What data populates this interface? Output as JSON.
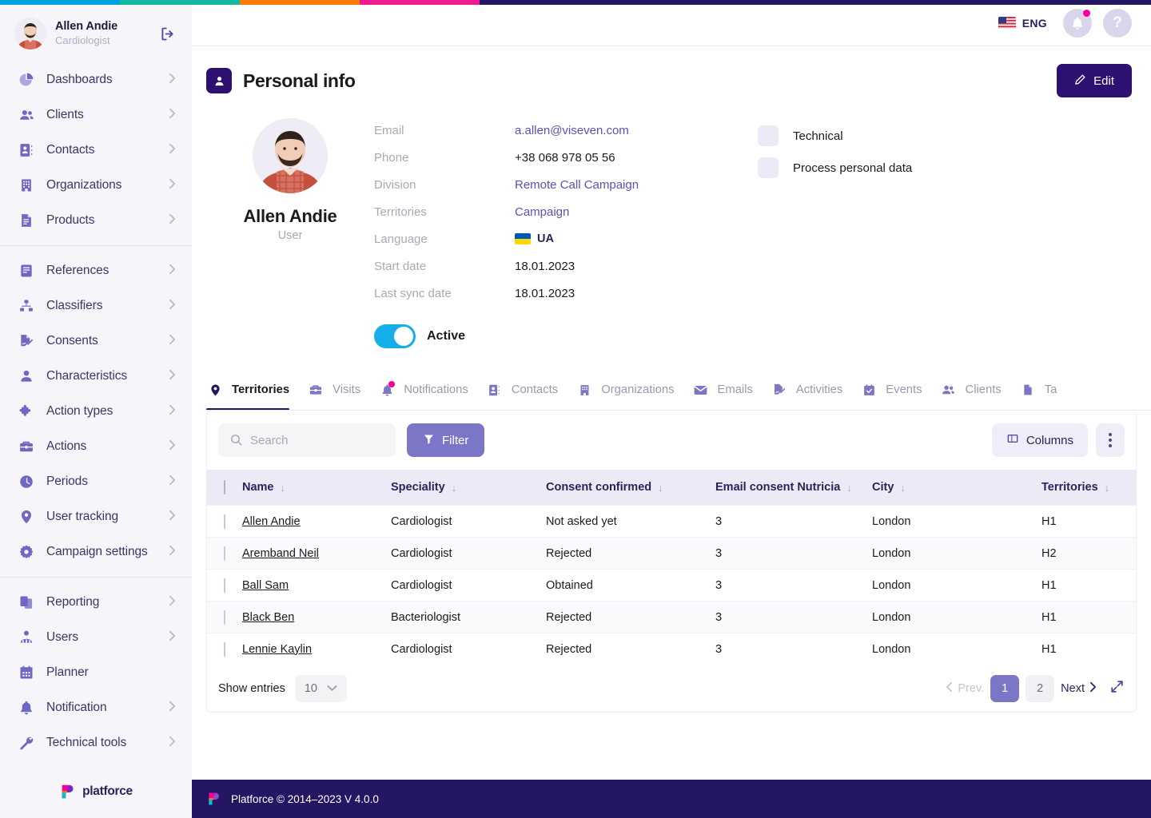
{
  "brand": {
    "name": "platforce",
    "footer_text": "Platforce © 2014–2023 V 4.0.0"
  },
  "topstrip": [
    "#00a3e0",
    "#12b8a0",
    "#f97b00",
    "#ef1a8f",
    "#241663"
  ],
  "sidebar": {
    "profile": {
      "name": "Allen Andie",
      "role": "Cardiologist",
      "logout_icon": "logout-icon"
    },
    "groups": [
      {
        "items": [
          {
            "label": "Dashboards",
            "icon": "pie-chart-icon",
            "chevron": true
          },
          {
            "label": "Clients",
            "icon": "people-icon",
            "chevron": true
          },
          {
            "label": "Contacts",
            "icon": "contact-book-icon",
            "chevron": true
          },
          {
            "label": "Organizations",
            "icon": "building-icon",
            "chevron": true
          },
          {
            "label": "Products",
            "icon": "document-icon",
            "chevron": true
          }
        ]
      },
      {
        "items": [
          {
            "label": "References",
            "icon": "book-icon",
            "chevron": true
          },
          {
            "label": "Classifiers",
            "icon": "hierarchy-icon",
            "chevron": true
          },
          {
            "label": "Consents",
            "icon": "signature-icon",
            "chevron": true
          },
          {
            "label": "Characteristics",
            "icon": "person-icon",
            "chevron": true
          },
          {
            "label": "Action types",
            "icon": "puzzle-icon",
            "chevron": true
          },
          {
            "label": "Actions",
            "icon": "briefcase-icon",
            "chevron": true
          },
          {
            "label": "Periods",
            "icon": "clock-icon",
            "chevron": true
          },
          {
            "label": "User tracking",
            "icon": "location-pin-icon",
            "chevron": true
          },
          {
            "label": "Campaign settings",
            "icon": "gear-icon",
            "chevron": true
          }
        ]
      },
      {
        "items": [
          {
            "label": "Reporting",
            "icon": "clipboard-icon",
            "chevron": true
          },
          {
            "label": "Users",
            "icon": "users-icon",
            "chevron": true
          },
          {
            "label": "Planner",
            "icon": "calendar-icon",
            "chevron": false
          },
          {
            "label": "Notification",
            "icon": "bell-icon",
            "chevron": true
          },
          {
            "label": "Technical tools",
            "icon": "wrench-icon",
            "chevron": true
          }
        ]
      }
    ]
  },
  "topbar": {
    "language": "ENG",
    "flag": "us-flag-icon",
    "notifications_icon": "bell-icon",
    "help_icon": "question-mark-icon",
    "has_notification_badge": true
  },
  "page": {
    "title": "Personal info",
    "icon": "user-card-icon",
    "edit_label": "Edit",
    "edit_icon": "pencil-icon"
  },
  "personal": {
    "name": "Allen Andie",
    "role": "User",
    "fields": [
      {
        "label": "Email",
        "value": "a.allen@viseven.com",
        "type": "link"
      },
      {
        "label": "Phone",
        "value": "+38 068 978 05 56",
        "type": "text"
      },
      {
        "label": "Division",
        "value": "Remote Call Campaign",
        "type": "link"
      },
      {
        "label": "Territories",
        "value": "Campaign",
        "type": "link"
      },
      {
        "label": "Language",
        "value": "UA",
        "type": "flag"
      },
      {
        "label": "Start date",
        "value": "18.01.2023",
        "type": "text"
      },
      {
        "label": "Last sync date",
        "value": "18.01.2023",
        "type": "text"
      }
    ],
    "active_label": "Active",
    "active": true,
    "checkboxes": [
      {
        "label": "Technical",
        "checked": false
      },
      {
        "label": "Process personal data",
        "checked": false
      }
    ]
  },
  "tabs": [
    {
      "label": "Territories",
      "icon": "location-pin-icon",
      "active": true,
      "badge": false
    },
    {
      "label": "Visits",
      "icon": "briefcase-icon",
      "active": false,
      "badge": false
    },
    {
      "label": "Notifications",
      "icon": "bell-icon",
      "active": false,
      "badge": true
    },
    {
      "label": "Contacts",
      "icon": "contact-book-icon",
      "active": false,
      "badge": false
    },
    {
      "label": "Organizations",
      "icon": "building-icon",
      "active": false,
      "badge": false
    },
    {
      "label": "Emails",
      "icon": "envelope-icon",
      "active": false,
      "badge": false
    },
    {
      "label": "Activities",
      "icon": "signature-icon",
      "active": false,
      "badge": false
    },
    {
      "label": "Events",
      "icon": "calendar-check-icon",
      "active": false,
      "badge": false
    },
    {
      "label": "Clients",
      "icon": "people-icon",
      "active": false,
      "badge": false
    },
    {
      "label": "Ta",
      "icon": "document-icon",
      "active": false,
      "badge": false
    }
  ],
  "toolbar": {
    "search_placeholder": "Search",
    "search_value": "",
    "search_icon": "search-icon",
    "filter_label": "Filter",
    "filter_icon": "funnel-icon",
    "columns_label": "Columns",
    "columns_icon": "columns-icon",
    "kebab_icon": "more-vertical-icon"
  },
  "table": {
    "columns": [
      {
        "label": "Name",
        "sort": "↓"
      },
      {
        "label": "Speciality",
        "sort": "↓"
      },
      {
        "label": "Consent confirmed",
        "sort": "↓"
      },
      {
        "label": "Email consent Nutricia",
        "sort": "↓"
      },
      {
        "label": "City",
        "sort": "↓"
      },
      {
        "label": "Territories",
        "sort": "↓"
      }
    ],
    "rows": [
      {
        "name": "Allen Andie",
        "speciality": "Cardiologist",
        "consent": "Not asked yet",
        "email_consent": "3",
        "city": "London",
        "territories": "H1"
      },
      {
        "name": "Aremband Neil",
        "speciality": "Cardiologist",
        "consent": "Rejected",
        "email_consent": "3",
        "city": "London",
        "territories": "H2"
      },
      {
        "name": "Ball Sam",
        "speciality": "Cardiologist",
        "consent": "Obtained",
        "email_consent": "3",
        "city": "London",
        "territories": "H1"
      },
      {
        "name": "Black Ben",
        "speciality": "Bacteriologist",
        "consent": "Rejected",
        "email_consent": "3",
        "city": "London",
        "territories": "H1"
      },
      {
        "name": "Lennie Kaylin",
        "speciality": "Cardiologist",
        "consent": "Rejected",
        "email_consent": "3",
        "city": "London",
        "territories": "H1"
      }
    ]
  },
  "pagination": {
    "show_entries_label": "Show entries",
    "entries_value": "10",
    "prev_label": "Prev.",
    "next_label": "Next",
    "pages": [
      {
        "n": "1",
        "active": true
      },
      {
        "n": "2",
        "active": false
      }
    ],
    "expand_icon": "expand-icon"
  },
  "colors": {
    "accent": "#241663",
    "purple": "#7c76c7",
    "toggle_on": "#16aee8",
    "badge_pink": "#f5009b",
    "header_bg": "#eceaf6"
  }
}
